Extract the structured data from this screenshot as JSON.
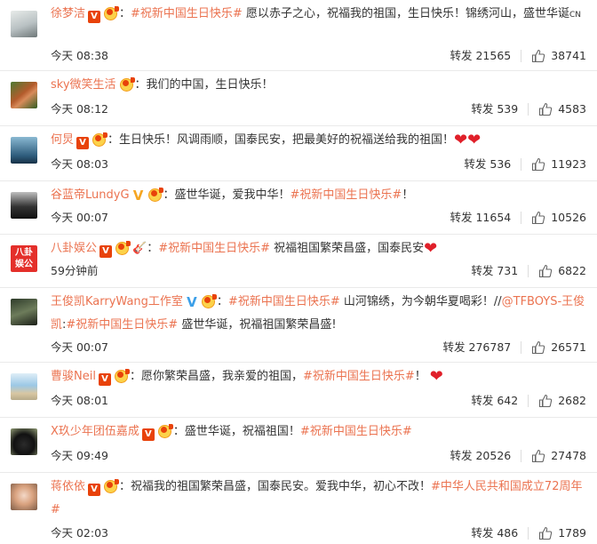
{
  "comments": [
    {
      "username": "徐梦洁",
      "text_before": "：",
      "hashtag": "#祝新中国生日快乐#",
      "text_after": " 愿以赤子之心，祝福我的祖国，生日快乐！锦绣河山，盛世华诞",
      "suffix": "CN",
      "time": "今天 08:38",
      "forward_label": "转发 21565",
      "likes": "38741"
    },
    {
      "username": "sky微笑生活",
      "text_before": "：我们的中国，生日快乐！",
      "time": "今天 08:12",
      "forward_label": "转发 539",
      "likes": "4583"
    },
    {
      "username": "何炅",
      "text_before": "：生日快乐！风调雨顺，国泰民安，把最美好的祝福送给我的祖国！",
      "time": "今天 08:03",
      "forward_label": "转发 536",
      "likes": "11923"
    },
    {
      "username": "谷蓝帝LundyG",
      "text_before": "：盛世华诞，爱我中华！",
      "hashtag": "#祝新中国生日快乐#",
      "text_after": "！",
      "time": "今天 00:07",
      "forward_label": "转发 11654",
      "likes": "10526"
    },
    {
      "username": "八卦娱公",
      "text_before": "：",
      "hashtag": "#祝新中国生日快乐#",
      "text_after": " 祝福祖国繁荣昌盛，国泰民安",
      "time": "59分钟前",
      "forward_label": "转发 731",
      "likes": "6822",
      "avatar_text": "八卦\n娱公"
    },
    {
      "username": "王俊凯KarryWang工作室",
      "text_before": "：",
      "hashtag": "#祝新中国生日快乐#",
      "text_after": " 山河锦绣，为今朝华夏喝彩！//",
      "mention": "@TFBOYS-王俊凯",
      "text_mid": ":",
      "hashtag2": "#祝新中国生日快乐#",
      "text_end": " 盛世华诞，祝福祖国繁荣昌盛!",
      "time": "今天 00:07",
      "forward_label": "转发 276787",
      "likes": "26571"
    },
    {
      "username": "曹骏Neil",
      "text_before": "：愿你繁荣昌盛，我亲爱的祖国，",
      "hashtag": "#祝新中国生日快乐#",
      "text_after": "！",
      "time": "今天 08:01",
      "forward_label": "转发 642",
      "likes": "2682"
    },
    {
      "username": "X玖少年团伍嘉成",
      "text_before": "：盛世华诞，祝福祖国！",
      "hashtag": "#祝新中国生日快乐#",
      "time": "今天 09:49",
      "forward_label": "转发 20526",
      "likes": "27478"
    },
    {
      "username": "蒋依依",
      "text_before": "：祝福我的祖国繁荣昌盛，国泰民安。爱我中华，初心不改！",
      "hashtag": "#中华人民共和国成立72周年#",
      "time": "今天 02:03",
      "forward_label": "转发 486",
      "likes": "1789"
    }
  ],
  "icons": {
    "verified_red": "V",
    "verified_gold": "V",
    "verified_blue": "V",
    "heart": "❤",
    "guitar": "🎸"
  },
  "colors": {
    "username": "#eb7350",
    "hashtag": "#eb7350",
    "verified_red": "#e8420a",
    "heart": "#e0202a"
  }
}
